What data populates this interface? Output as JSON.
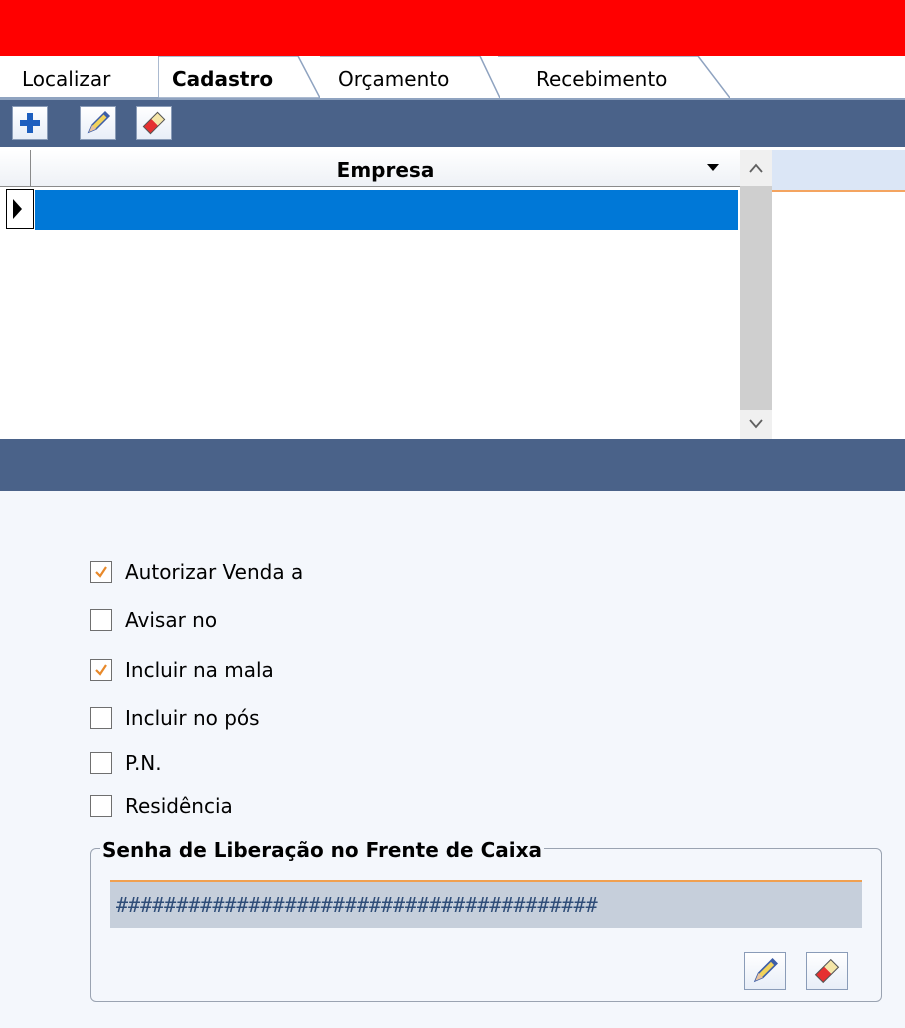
{
  "tabs": [
    {
      "label": "Localizar",
      "active": false
    },
    {
      "label": "Cadastro",
      "active": true
    },
    {
      "label": "Orçamento",
      "active": false
    },
    {
      "label": "Recebimento",
      "active": false
    }
  ],
  "toolbar": {
    "buttons": [
      {
        "icon": "plus-icon"
      },
      {
        "icon": "pencil-icon"
      },
      {
        "icon": "eraser-icon"
      }
    ]
  },
  "grid": {
    "columns": [
      "Empresa"
    ],
    "rows": [
      ""
    ]
  },
  "checkboxes": [
    {
      "label": "Autorizar Venda a",
      "checked": true
    },
    {
      "label": "Avisar no",
      "checked": false
    },
    {
      "label": "Incluir na mala",
      "checked": true
    },
    {
      "label": "Incluir no pós",
      "checked": false
    },
    {
      "label": "P.N.",
      "checked": false
    },
    {
      "label": "Residência",
      "checked": false
    }
  ],
  "password_group": {
    "title": "Senha de Liberação no Frente de Caixa",
    "value": "########################################"
  },
  "colors": {
    "header_red": "#ff0000",
    "toolbar_blue": "#4a6289",
    "selection_blue": "#0078d7",
    "check_orange": "#e8892a"
  }
}
